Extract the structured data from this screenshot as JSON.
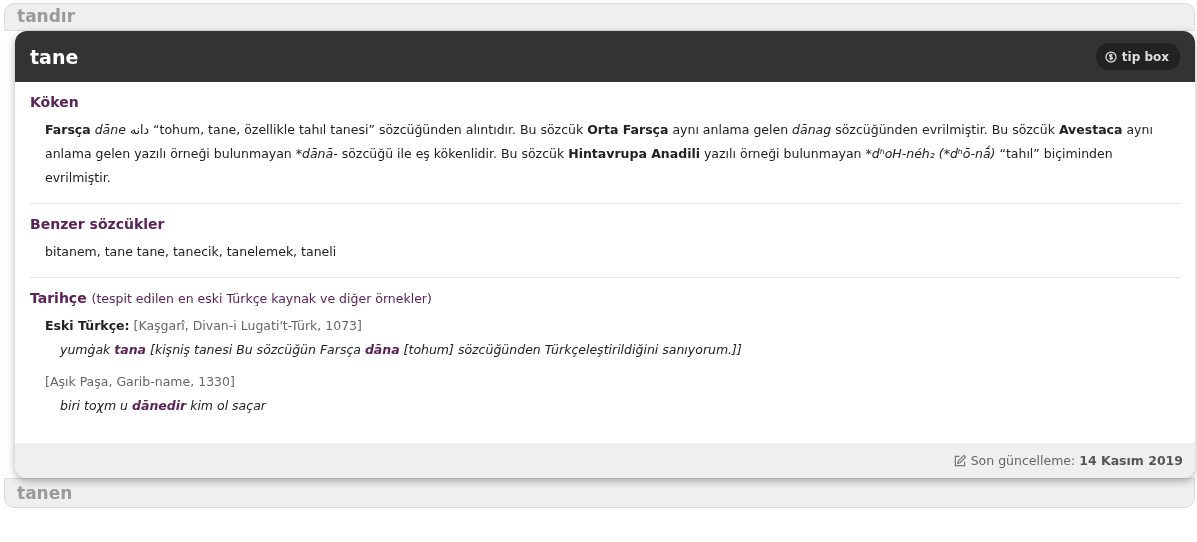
{
  "previous_entry": {
    "title": "tandır"
  },
  "entry": {
    "title": "tane",
    "tip_button": "tip box",
    "sections": [
      {
        "kind": "origin",
        "heading": "Köken",
        "paragraph": [
          {
            "kind": "language",
            "text": "Farsça"
          },
          {
            "kind": "form",
            "text": "dāne"
          },
          {
            "kind": "text",
            "text": "دانه “tohum, tane, özellikle tahıl tanesi” sözcüğünden alıntıdır. Bu sözcük"
          },
          {
            "kind": "language",
            "text": "Orta Farsça"
          },
          {
            "kind": "text",
            "text": "aynı anlama gelen"
          },
          {
            "kind": "form",
            "text": "dānag"
          },
          {
            "kind": "text",
            "text": "sözcüğünden evrilmiştir. Bu sözcük"
          },
          {
            "kind": "language",
            "text": "Avestaca"
          },
          {
            "kind": "text",
            "text": "aynı anlama gelen yazılı örneği bulunmayan"
          },
          {
            "kind": "form",
            "text": "*dānā-"
          },
          {
            "kind": "text",
            "text": "sözcüğü ile eş kökenlidir. Bu sözcük"
          },
          {
            "kind": "language",
            "text": "Hintavrupa Anadili"
          },
          {
            "kind": "text",
            "text": "yazılı örneği bulunmayan"
          },
          {
            "kind": "form",
            "text": "*dʰoH-néh₂ (*dʰō-nā́)"
          },
          {
            "kind": "text",
            "text": "“tahıl” biçiminden evrilmiştir."
          }
        ]
      },
      {
        "kind": "related",
        "heading": "Benzer sözcükler",
        "text": "bitanem, tane tane, tanecik, tanelemek, taneli"
      },
      {
        "kind": "history",
        "heading": "Tarihçe",
        "subheading": "(tespit edilen en eski Türkçe kaynak ve diğer örnekler)",
        "entries": [
          {
            "language": "Eski Türkçe:",
            "source": "[Kaşgarî, Divan-i Lugati't-Türk, 1073]",
            "quote": "yumġak **tana** [kişniş tanesi Bu sözcüğün Farsça **dāna** [tohum] sözcüğünden Türkçeleştirildiğini sanıyorum.]]"
          },
          {
            "source": "[Aşık Paşa, Garib-name, 1330]",
            "quote": "biri toχm u **dānedir** kim ol saçar"
          }
        ]
      }
    ],
    "footer": {
      "label": "Son güncelleme:",
      "date": "14 Kasım 2019"
    }
  },
  "next_entry": {
    "title": "tanen"
  }
}
